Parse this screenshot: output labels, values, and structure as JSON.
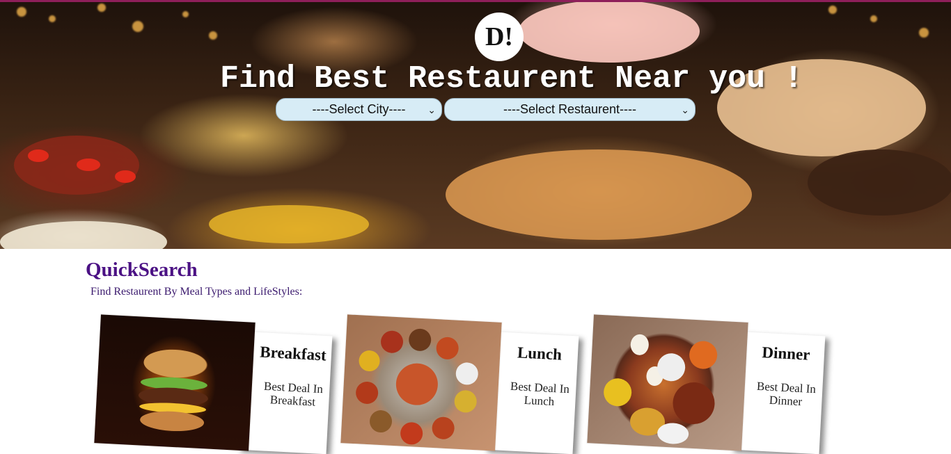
{
  "brand": {
    "logo_text": "D!"
  },
  "hero": {
    "title": "Find Best Restaurent Near you !",
    "city_select": {
      "selected": "----Select City----"
    },
    "restaurant_select": {
      "selected": "----Select Restaurent----"
    },
    "colors": {
      "accent_line": "#8e1f5a",
      "select_bg": "#d7ecf6"
    }
  },
  "quick_search": {
    "title": "QuickSearch",
    "subtitle": "Find Restaurent By Meal Types and LifeStyles:",
    "title_color": "#4b1184",
    "cards": [
      {
        "label": "Breakfast",
        "desc": "Best Deal In Breakfast",
        "image_icon": "burger-image"
      },
      {
        "label": "Lunch",
        "desc": "Best Deal In Lunch",
        "image_icon": "thali-image"
      },
      {
        "label": "Dinner",
        "desc": "Best Deal In Dinner",
        "image_icon": "dinner-platter-image"
      }
    ]
  }
}
